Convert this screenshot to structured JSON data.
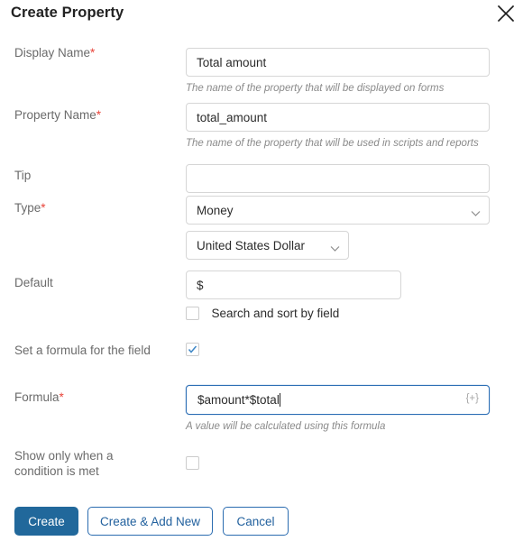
{
  "dialog": {
    "title": "Create Property",
    "close_icon": "close-icon"
  },
  "fields": {
    "display_name": {
      "label": "Display Name",
      "required_marker": "*",
      "value": "Total amount",
      "placeholder": "",
      "helper": "The name of the property that will be displayed on forms"
    },
    "property_name": {
      "label": "Property Name",
      "required_marker": "*",
      "value": "total_amount",
      "placeholder": "",
      "helper": "The name of the property that will be used in scripts and reports"
    },
    "tip": {
      "label": "Tip",
      "value": "",
      "placeholder": ""
    },
    "type": {
      "label": "Type",
      "required_marker": "*",
      "selected": "Money",
      "chevron_icon": "chevron-down-icon"
    },
    "currency": {
      "selected": "United States Dollar",
      "chevron_icon": "chevron-down-icon"
    },
    "default": {
      "label": "Default",
      "value": "$",
      "placeholder": ""
    },
    "search_sort": {
      "label": "Search and sort by field",
      "checked": false
    },
    "set_formula": {
      "label": "Set a formula for the field",
      "checked": true
    },
    "formula": {
      "label": "Formula",
      "required_marker": "*",
      "value": "$amount*$total",
      "hint": "{+}",
      "helper": "A value will be calculated using this formula",
      "focused": true
    },
    "show_condition": {
      "label_line1": "Show only when a",
      "label_line2": "condition is met",
      "checked": false
    }
  },
  "footer": {
    "create_label": "Create",
    "create_add_new_label": "Create & Add New",
    "cancel_label": "Cancel"
  },
  "colors": {
    "primary": "#21689b",
    "outline_border": "#2b6cb0",
    "required_red": "#e8443a",
    "focus_blue": "#2c6eb5",
    "label_grey": "#6b6b6b",
    "helper_grey": "#8a8a8a",
    "input_border": "#d6d6d6"
  }
}
